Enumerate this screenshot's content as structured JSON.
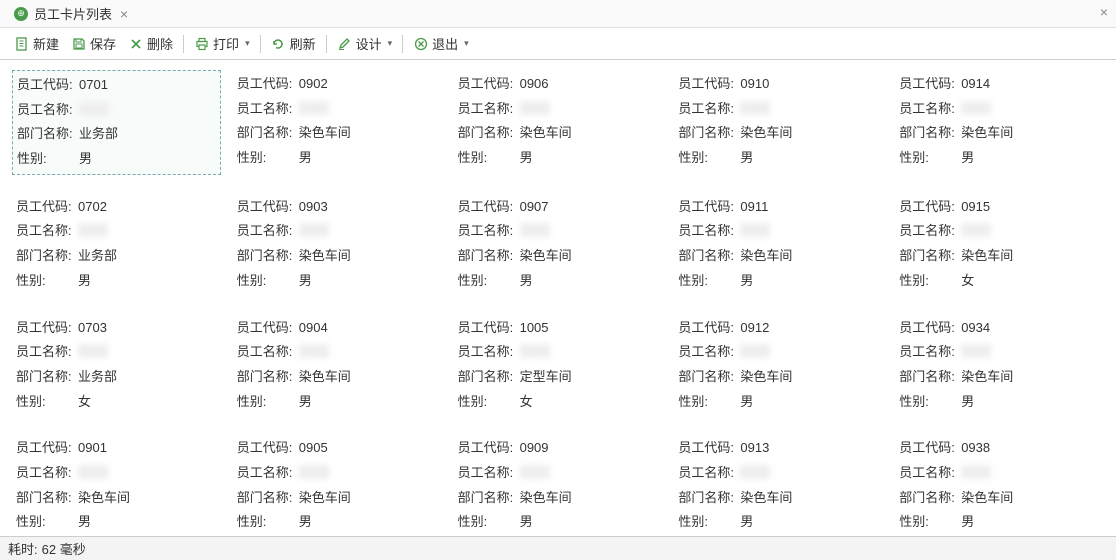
{
  "tab": {
    "title": "员工卡片列表"
  },
  "toolbar": {
    "new_label": "新建",
    "save_label": "保存",
    "delete_label": "删除",
    "print_label": "打印",
    "refresh_label": "刷新",
    "design_label": "设计",
    "exit_label": "退出"
  },
  "field_labels": {
    "code": "员工代码:",
    "name": "员工名称:",
    "dept": "部门名称:",
    "gender": "性别:"
  },
  "cards": [
    {
      "code": "0701",
      "dept": "业务部",
      "gender": "男",
      "selected": true
    },
    {
      "code": "0702",
      "dept": "业务部",
      "gender": "男"
    },
    {
      "code": "0703",
      "dept": "业务部",
      "gender": "女"
    },
    {
      "code": "0901",
      "dept": "染色车间",
      "gender": "男"
    },
    {
      "code": "0902",
      "dept": "染色车间",
      "gender": "男"
    },
    {
      "code": "0903",
      "dept": "染色车间",
      "gender": "男"
    },
    {
      "code": "0904",
      "dept": "染色车间",
      "gender": "男"
    },
    {
      "code": "0905",
      "dept": "染色车间",
      "gender": "男"
    },
    {
      "code": "0906",
      "dept": "染色车间",
      "gender": "男"
    },
    {
      "code": "0907",
      "dept": "染色车间",
      "gender": "男"
    },
    {
      "code": "1005",
      "dept": "定型车间",
      "gender": "女"
    },
    {
      "code": "0909",
      "dept": "染色车间",
      "gender": "男"
    },
    {
      "code": "0910",
      "dept": "染色车间",
      "gender": "男"
    },
    {
      "code": "0911",
      "dept": "染色车间",
      "gender": "男"
    },
    {
      "code": "0912",
      "dept": "染色车间",
      "gender": "男"
    },
    {
      "code": "0913",
      "dept": "染色车间",
      "gender": "男"
    },
    {
      "code": "0914",
      "dept": "染色车间",
      "gender": "男"
    },
    {
      "code": "0915",
      "dept": "染色车间",
      "gender": "女"
    },
    {
      "code": "0934",
      "dept": "染色车间",
      "gender": "男"
    },
    {
      "code": "0938",
      "dept": "染色车间",
      "gender": "男"
    }
  ],
  "status": {
    "prefix": "耗时:",
    "value": "62 毫秒"
  }
}
